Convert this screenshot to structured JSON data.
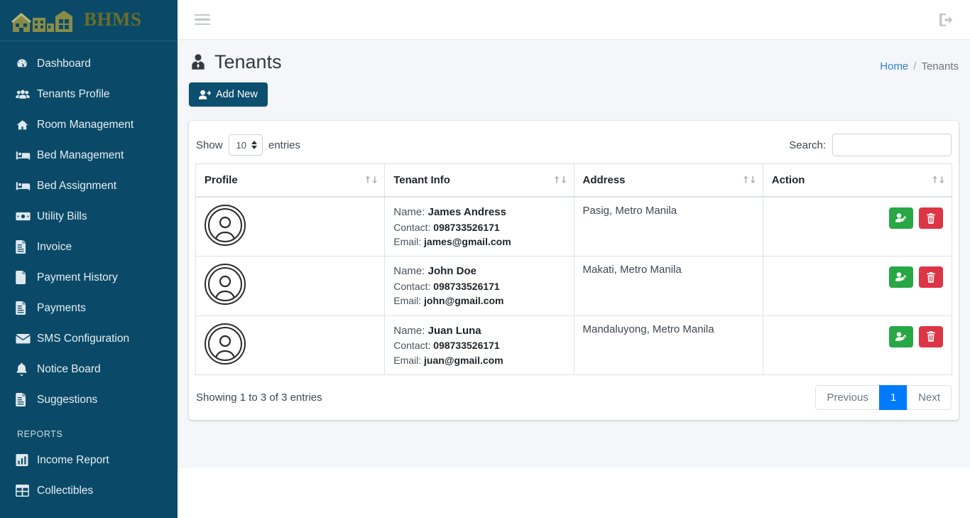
{
  "brand": {
    "name": "BHMS",
    "logo_icon": "buildings-logo-icon"
  },
  "sidebar": {
    "items": [
      {
        "label": "Dashboard",
        "icon": "tachometer-icon"
      },
      {
        "label": "Tenants Profile",
        "icon": "users-icon"
      },
      {
        "label": "Room Management",
        "icon": "home-icon"
      },
      {
        "label": "Bed Management",
        "icon": "bed-icon"
      },
      {
        "label": "Bed Assignment",
        "icon": "bed-icon"
      },
      {
        "label": "Utility Bills",
        "icon": "money-bill-icon"
      },
      {
        "label": "Invoice",
        "icon": "file-invoice-icon"
      },
      {
        "label": "Payment History",
        "icon": "file-icon"
      },
      {
        "label": "Payments",
        "icon": "file-invoice-icon"
      },
      {
        "label": "SMS Configuration",
        "icon": "envelope-icon"
      },
      {
        "label": "Notice Board",
        "icon": "bell-icon"
      },
      {
        "label": "Suggestions",
        "icon": "file-invoice-icon"
      }
    ],
    "reports_header": "REPORTS",
    "reports": [
      {
        "label": "Income Report",
        "icon": "chart-bar-icon"
      },
      {
        "label": "Collectibles",
        "icon": "table-icon"
      }
    ]
  },
  "topbar": {
    "menu_icon": "hamburger-icon",
    "signout_icon": "sign-out-icon"
  },
  "page": {
    "title": "Tenants",
    "title_icon": "user-tie-icon",
    "add_button": {
      "label": "Add New",
      "icon": "user-plus-icon"
    },
    "breadcrumb": {
      "home": "Home",
      "separator": "/",
      "current": "Tenants"
    }
  },
  "datatable": {
    "length": {
      "show_label": "Show",
      "value": "10",
      "entries_label": "entries"
    },
    "search": {
      "label": "Search:",
      "value": "",
      "placeholder": ""
    },
    "columns": [
      "Profile",
      "Tenant Info",
      "Address",
      "Action"
    ],
    "sort_icon": "↑↓",
    "rows": [
      {
        "avatar_icon": "user-avatar-placeholder-icon",
        "name_label": "Name:",
        "name": "James Andress",
        "contact_label": "Contact:",
        "contact": "098733526171",
        "email_label": "Email:",
        "email": "james@gmail.com",
        "address": "Pasig, Metro Manila",
        "actions": [
          {
            "name": "edit-tenant-button",
            "icon": "user-edit-icon",
            "color": "#28a745"
          },
          {
            "name": "delete-tenant-button",
            "icon": "trash-icon",
            "color": "#dc3545"
          }
        ]
      },
      {
        "avatar_icon": "user-avatar-placeholder-icon",
        "name_label": "Name:",
        "name": "John Doe",
        "contact_label": "Contact:",
        "contact": "098733526171",
        "email_label": "Email:",
        "email": "john@gmail.com",
        "address": "Makati, Metro Manila",
        "actions": [
          {
            "name": "edit-tenant-button",
            "icon": "user-edit-icon",
            "color": "#28a745"
          },
          {
            "name": "delete-tenant-button",
            "icon": "trash-icon",
            "color": "#dc3545"
          }
        ]
      },
      {
        "avatar_icon": "user-avatar-placeholder-icon",
        "name_label": "Name:",
        "name": "Juan Luna",
        "contact_label": "Contact:",
        "contact": "098733526171",
        "email_label": "Email:",
        "email": "juan@gmail.com",
        "address": "Mandaluyong, Metro Manila",
        "actions": [
          {
            "name": "edit-tenant-button",
            "icon": "user-edit-icon",
            "color": "#28a745"
          },
          {
            "name": "delete-tenant-button",
            "icon": "trash-icon",
            "color": "#dc3545"
          }
        ]
      }
    ],
    "info": "Showing 1 to 3 of 3 entries",
    "pagination": {
      "previous": "Previous",
      "pages": [
        "1"
      ],
      "next": "Next",
      "active": "1"
    }
  },
  "colors": {
    "sidebar_bg": "#0a4a68",
    "content_bg": "#f4f6f9",
    "accent_blue": "#007bff",
    "link_blue": "#2e7fd4",
    "success_green": "#28a745",
    "danger_red": "#dc3545",
    "logo_olive": "#8a8c46"
  }
}
